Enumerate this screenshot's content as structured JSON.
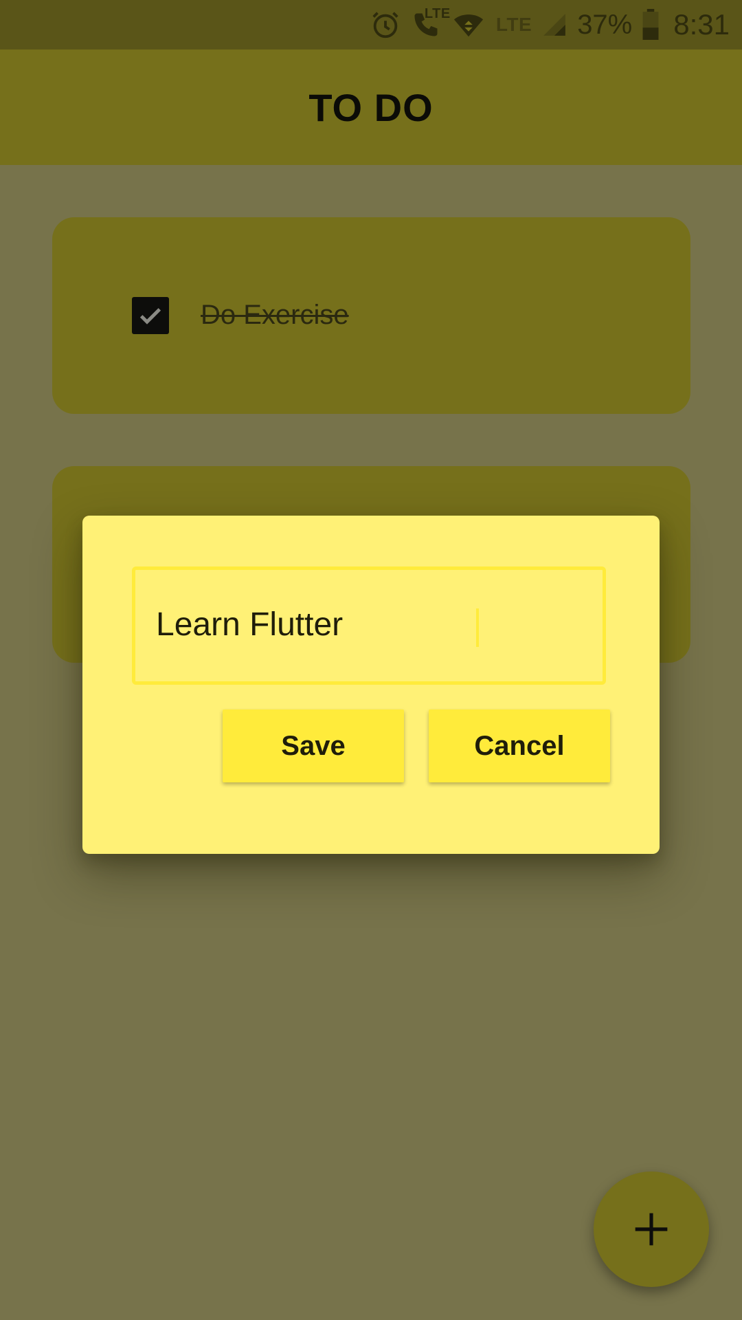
{
  "status_bar": {
    "icons": [
      "alarm-icon",
      "call-lte-icon",
      "wifi-icon",
      "lte-icon",
      "cell-signal-icon",
      "battery-icon"
    ],
    "call_lte_label": "LTE",
    "lte_label": "LTE",
    "battery_percent": "37%",
    "time": "8:31"
  },
  "app_bar": {
    "title": "TO DO"
  },
  "todo_list": {
    "items": [
      {
        "label": "Do Exercise",
        "checked": true
      }
    ]
  },
  "dialog": {
    "input_value": "Learn Flutter",
    "save_label": "Save",
    "cancel_label": "Cancel"
  },
  "fab": {
    "icon": "plus-icon"
  },
  "colors": {
    "status_bar": "#5a5518",
    "app_bar": "#76701b",
    "scrim_background": "#77734b",
    "dialog_background": "#fff176",
    "accent": "#ffeb3b"
  }
}
